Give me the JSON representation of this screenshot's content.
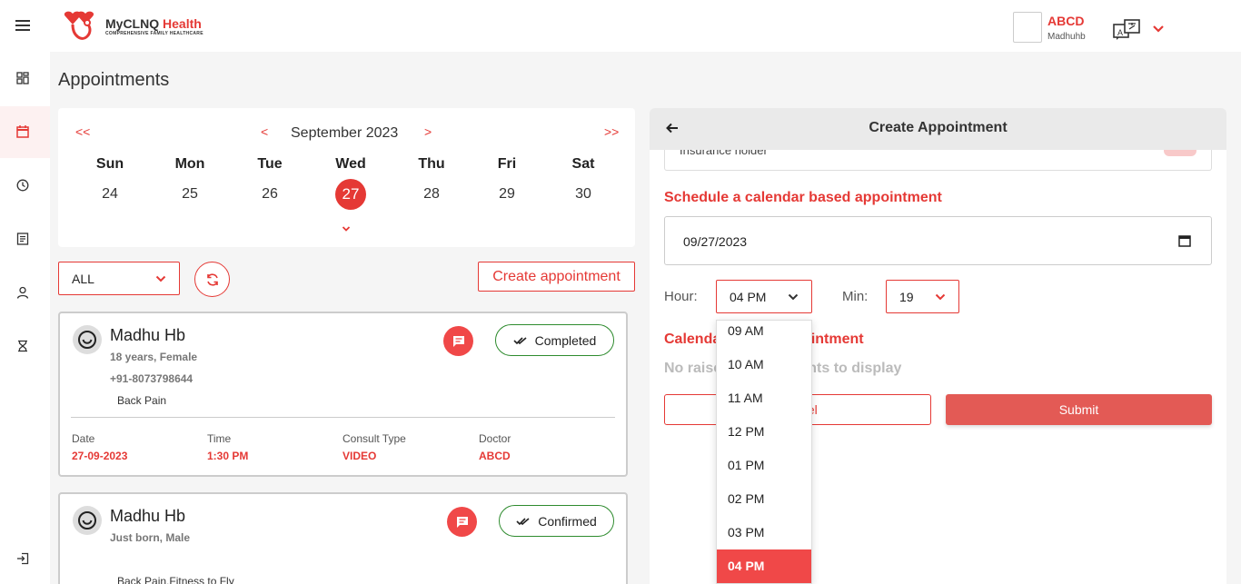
{
  "header": {
    "app_name_1": "MyCLNQ",
    "app_name_2": "Health",
    "tagline": "COMPREHENSIVE FAMILY HEALTHCARE",
    "user_name": "ABCD",
    "user_role": "Madhuhb"
  },
  "sidebar": {
    "items": [
      {
        "icon": "menu-icon"
      },
      {
        "icon": "dashboard-icon"
      },
      {
        "icon": "calendar-icon",
        "active": true
      },
      {
        "icon": "clock-icon"
      },
      {
        "icon": "document-icon"
      },
      {
        "icon": "user-icon"
      },
      {
        "icon": "hourglass-icon"
      },
      {
        "icon": "logout-icon"
      }
    ]
  },
  "page": {
    "title": "Appointments"
  },
  "calendar": {
    "prev_year": "<<",
    "prev_month": "<",
    "month_label": "September 2023",
    "next_month": ">",
    "next_year": ">>",
    "days": [
      {
        "name": "Sun",
        "num": "24"
      },
      {
        "name": "Mon",
        "num": "25"
      },
      {
        "name": "Tue",
        "num": "26"
      },
      {
        "name": "Wed",
        "num": "27"
      },
      {
        "name": "Thu",
        "num": "28"
      },
      {
        "name": "Fri",
        "num": "29"
      },
      {
        "name": "Sat",
        "num": "30"
      }
    ],
    "selected_day": "27"
  },
  "filters": {
    "status_value": "ALL",
    "create_label": "Create appointment"
  },
  "appointments": [
    {
      "name": "Madhu Hb",
      "age_gender": "18 years, Female",
      "phone": "+91-8073798644",
      "reason": "Back Pain",
      "status": "Completed",
      "labels": {
        "date": "Date",
        "time": "Time",
        "type": "Consult Type",
        "doctor": "Doctor"
      },
      "values": {
        "date": "27-09-2023",
        "time": "1:30 PM",
        "type": "VIDEO",
        "doctor": "ABCD"
      }
    },
    {
      "name": "Madhu Hb",
      "age_gender": "Just born, Male",
      "reason": "Back Pain,Fitness to Fly",
      "status": "Confirmed"
    }
  ],
  "create_panel": {
    "title": "Create Appointment",
    "insurance_label": "Insurance holder",
    "schedule_title": "Schedule a calendar based appointment",
    "date_value": "09/27/2023",
    "hour_label": "Hour:",
    "hour_value": "04 PM",
    "min_label": "Min:",
    "min_value": "19",
    "calendar_title": "Calendar based appointment",
    "no_raise_text": "No raised appointments to display",
    "cancel_label": "Cancel",
    "submit_label": "Submit"
  },
  "hour_dropdown": {
    "options": [
      "09 AM",
      "10 AM",
      "11 AM",
      "12 PM",
      "01 PM",
      "02 PM",
      "03 PM",
      "04 PM"
    ],
    "selected": "04 PM"
  },
  "colors": {
    "accent": "#e53935",
    "success": "#2e8b2e"
  }
}
